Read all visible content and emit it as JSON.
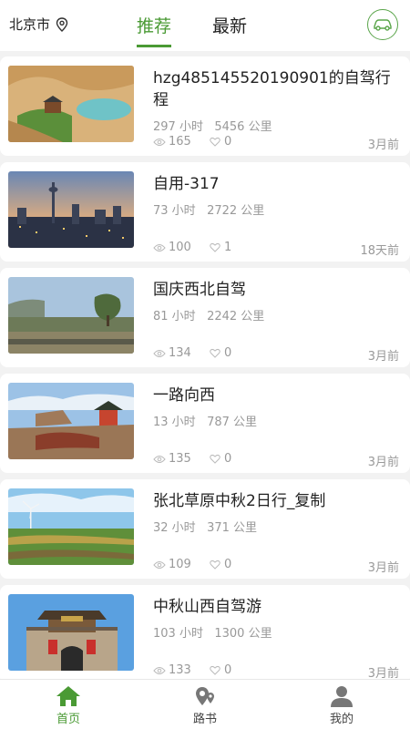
{
  "header": {
    "city": "北京市",
    "tabs": [
      "推荐",
      "最新"
    ]
  },
  "trips": [
    {
      "title": "hzg485145520190901的自驾行程",
      "hours": "297 小时",
      "km": "5456 公里",
      "views": "165",
      "likes": "0",
      "time": "3月前"
    },
    {
      "title": "自用-317",
      "hours": "73 小时",
      "km": "2722 公里",
      "views": "100",
      "likes": "1",
      "time": "18天前"
    },
    {
      "title": "国庆西北自驾",
      "hours": "81 小时",
      "km": "2242 公里",
      "views": "134",
      "likes": "0",
      "time": "3月前"
    },
    {
      "title": "一路向西",
      "hours": "13 小时",
      "km": "787 公里",
      "views": "135",
      "likes": "0",
      "time": "3月前"
    },
    {
      "title": "张北草原中秋2日行_复制",
      "hours": "32 小时",
      "km": "371 公里",
      "views": "109",
      "likes": "0",
      "time": "3月前"
    },
    {
      "title": "中秋山西自驾游",
      "hours": "103 小时",
      "km": "1300 公里",
      "views": "133",
      "likes": "0",
      "time": "3月前"
    }
  ],
  "tabbar": {
    "home": "首页",
    "routes": "路书",
    "mine": "我的"
  },
  "colors": {
    "accent": "#4a9a34"
  }
}
